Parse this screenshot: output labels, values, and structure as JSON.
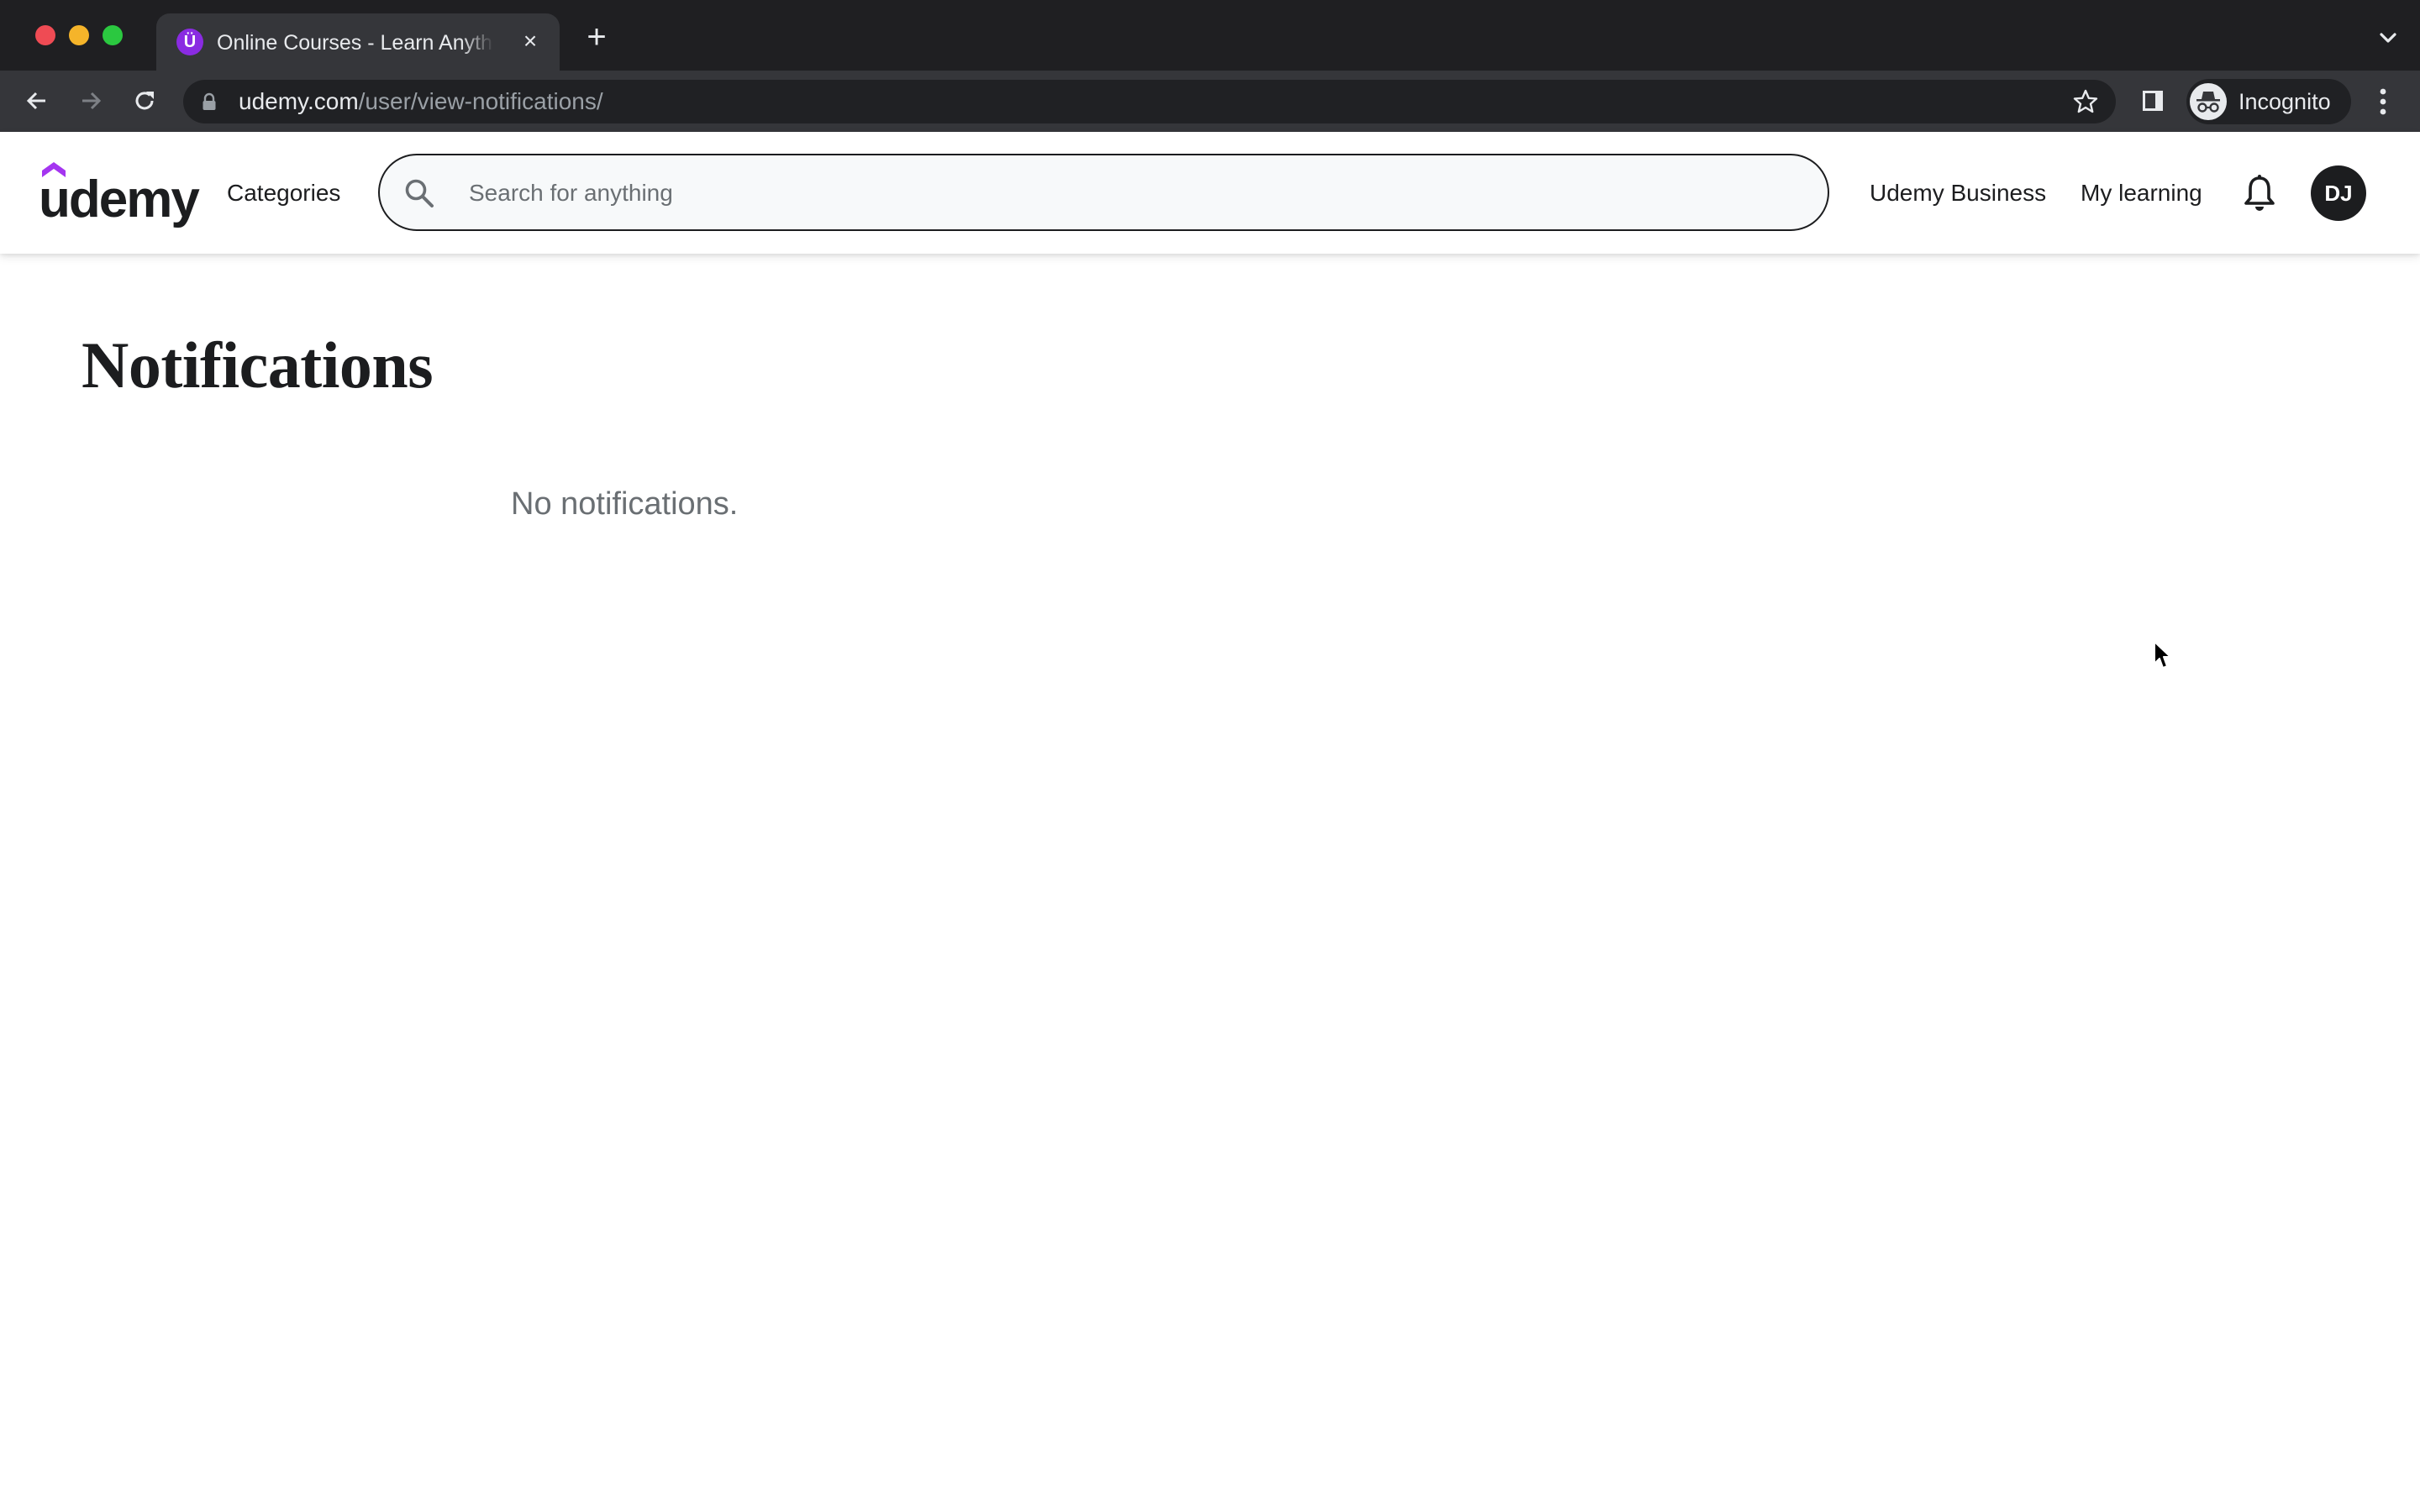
{
  "browser": {
    "tab": {
      "title": "Online Courses - Learn Anything",
      "favicon_letter": "Ü",
      "favicon_color": "#8a2be2"
    },
    "new_tab_label": "+",
    "close_tab_label": "×",
    "url": {
      "host": "udemy.com",
      "path": "/user/view-notifications/"
    },
    "profile_label": "Incognito",
    "icons": {
      "back": "arrow-left-icon",
      "forward": "arrow-right-icon",
      "reload": "reload-icon",
      "lock": "lock-icon",
      "bookmark": "star-icon",
      "side_panel": "side-panel-icon",
      "incognito": "incognito-icon",
      "menu": "kebab-menu-icon",
      "tab_list": "chevron-down-icon"
    }
  },
  "header": {
    "logo_text": "udemy",
    "brand_color": "#a435f0",
    "categories_label": "Categories",
    "search": {
      "placeholder": "Search for anything",
      "value": ""
    },
    "links": {
      "business": "Udemy Business",
      "my_learning": "My learning"
    },
    "avatar_initials": "DJ"
  },
  "main": {
    "title": "Notifications",
    "empty_message": "No notifications."
  }
}
